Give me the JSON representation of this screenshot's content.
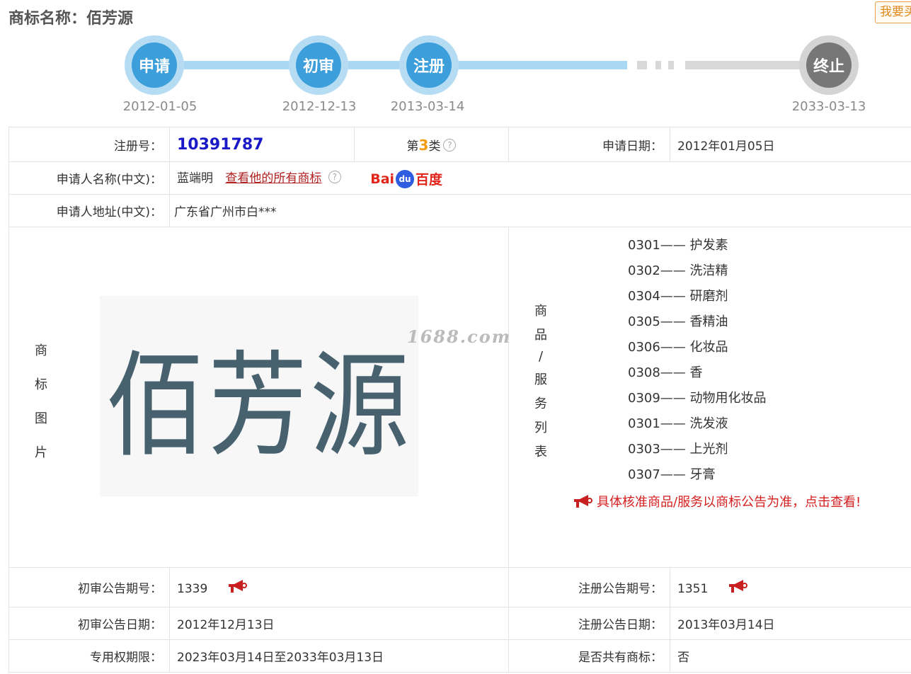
{
  "header": {
    "title_label": "商标名称：",
    "title_value": "佰芳源",
    "want_button": "我要买"
  },
  "timeline": {
    "nodes": [
      {
        "label": "申请",
        "date": "2012-01-05"
      },
      {
        "label": "初审",
        "date": "2012-12-13"
      },
      {
        "label": "注册",
        "date": "2013-03-14"
      },
      {
        "label": "终止",
        "date": "2033-03-13"
      }
    ]
  },
  "info": {
    "reg_no_label": "注册号：",
    "reg_no": "10391787",
    "class_prefix": "第",
    "class_num": "3",
    "class_suffix": "类",
    "apply_date_label": "申请日期：",
    "apply_date": "2012年01月05日",
    "applicant_label": "申请人名称(中文)：",
    "applicant": "蓝端明",
    "view_all": "查看他的所有商标",
    "baidu_left": "Bai",
    "baidu_paw": "du",
    "baidu_right": "百度",
    "address_label": "申请人地址(中文)：",
    "address": "广东省广州市白***",
    "image_label": [
      "商",
      "标",
      "图",
      "片"
    ],
    "image_text": "佰芳源",
    "watermark": "1688.com",
    "goods_label": [
      "商",
      "品",
      "/",
      "服",
      "务",
      "列",
      "表"
    ],
    "goods": [
      "0301—— 护发素",
      "0302—— 洗洁精",
      "0304—— 研磨剂",
      "0305—— 香精油",
      "0306—— 化妆品",
      "0308—— 香",
      "0309—— 动物用化妆品",
      "0301—— 洗发液",
      "0303—— 上光剂",
      "0307—— 牙膏"
    ],
    "goods_notice": "具体核准商品/服务以商标公告为准，点击查看!",
    "prelim_no_label": "初审公告期号：",
    "prelim_no": "1339",
    "reg_pub_no_label": "注册公告期号：",
    "reg_pub_no": "1351",
    "prelim_date_label": "初审公告日期：",
    "prelim_date": "2012年12月13日",
    "reg_pub_date_label": "注册公告日期：",
    "reg_pub_date": "2013年03月14日",
    "term_label": "专用权期限：",
    "term": "2023年03月14日至2033年03月13日",
    "shared_label": "是否共有商标：",
    "shared": "否"
  },
  "colors": {
    "active_node": "#3c9edb",
    "active_ring": "#b5dcf3",
    "ended_node": "#777777",
    "reg_no": "#1919c8",
    "notice": "#d41f1f"
  }
}
